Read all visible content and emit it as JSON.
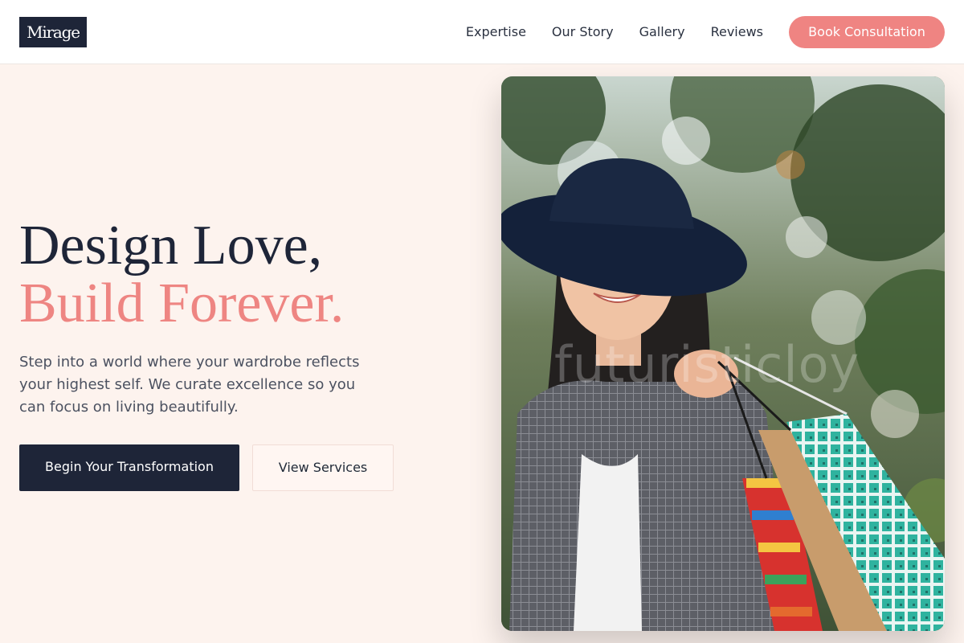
{
  "header": {
    "logo": "Mirage",
    "nav": [
      "Expertise",
      "Our Story",
      "Gallery",
      "Reviews"
    ],
    "cta": "Book Consultation"
  },
  "hero": {
    "title_line1": "Design Love,",
    "title_line2": "Build Forever.",
    "description": "Step into a world where your wardrobe reflects your highest self. We curate excellence so you can focus on living beautifully.",
    "primary_button": "Begin Your Transformation",
    "secondary_button": "View Services",
    "image_watermark": "futuristicloy"
  },
  "colors": {
    "brand_dark": "#1e2538",
    "accent_coral": "#ef8482",
    "background": "#fdf3ee"
  }
}
